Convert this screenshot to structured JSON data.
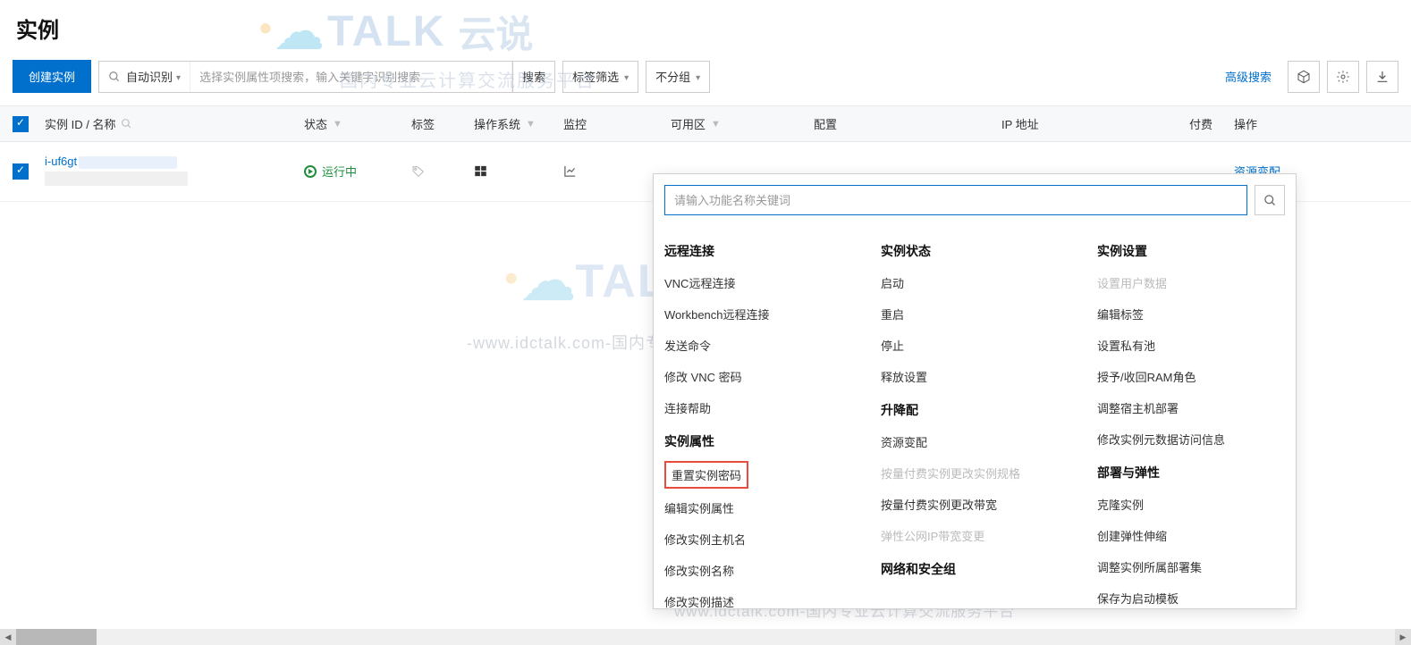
{
  "page_title": "实例",
  "toolbar": {
    "create_label": "创建实例",
    "auto_detect": "自动识别",
    "search_placeholder": "选择实例属性项搜索，输入关键字识别搜索",
    "search_btn": "搜索",
    "tag_filter": "标签筛选",
    "group_select": "不分组",
    "advanced": "高级搜索"
  },
  "columns": {
    "id": "实例 ID / 名称",
    "status": "状态",
    "tag": "标签",
    "os": "操作系统",
    "mon": "监控",
    "zone": "可用区",
    "cfg": "配置",
    "ip": "IP 地址",
    "pay": "付费",
    "act": "操作"
  },
  "row": {
    "id_prefix": "i-uf6gt",
    "status_text": "运行中",
    "action": "资源变配"
  },
  "panel": {
    "search_placeholder": "请输入功能名称关键词",
    "col1": {
      "g1": {
        "title": "远程连接",
        "items": [
          "VNC远程连接",
          "Workbench远程连接",
          "发送命令",
          "修改 VNC 密码",
          "连接帮助"
        ]
      },
      "g2": {
        "title": "实例属性",
        "items": [
          "重置实例密码",
          "编辑实例属性",
          "修改实例主机名",
          "修改实例名称",
          "修改实例描述"
        ]
      },
      "highlighted_index": 0
    },
    "col2": {
      "g1": {
        "title": "实例状态",
        "items": [
          "启动",
          "重启",
          "停止",
          "释放设置"
        ]
      },
      "g2": {
        "title": "升降配",
        "items": [
          "资源变配",
          "按量付费实例更改实例规格",
          "按量付费实例更改带宽",
          "弹性公网IP带宽变更"
        ],
        "disabled": [
          1,
          3
        ]
      },
      "g3": {
        "title": "网络和安全组",
        "items": []
      }
    },
    "col3": {
      "g1": {
        "title": "实例设置",
        "items": [
          "设置用户数据",
          "编辑标签",
          "设置私有池",
          "授予/收回RAM角色",
          "调整宿主机部署",
          "修改实例元数据访问信息"
        ],
        "disabled": [
          0
        ]
      },
      "g2": {
        "title": "部署与弹性",
        "items": [
          "克隆实例",
          "创建弹性伸缩",
          "调整实例所属部署集",
          "保存为启动模板"
        ]
      }
    }
  },
  "watermark": {
    "brand": "TALK",
    "cn": "云说",
    "sub1": "国内专业云计算交流服务平台",
    "sub2": "-www.idctalk.com-国内专业云计算交流服务平台-",
    "sub3": "www.idctalk.com-国内专业云计算交流服务平台"
  }
}
